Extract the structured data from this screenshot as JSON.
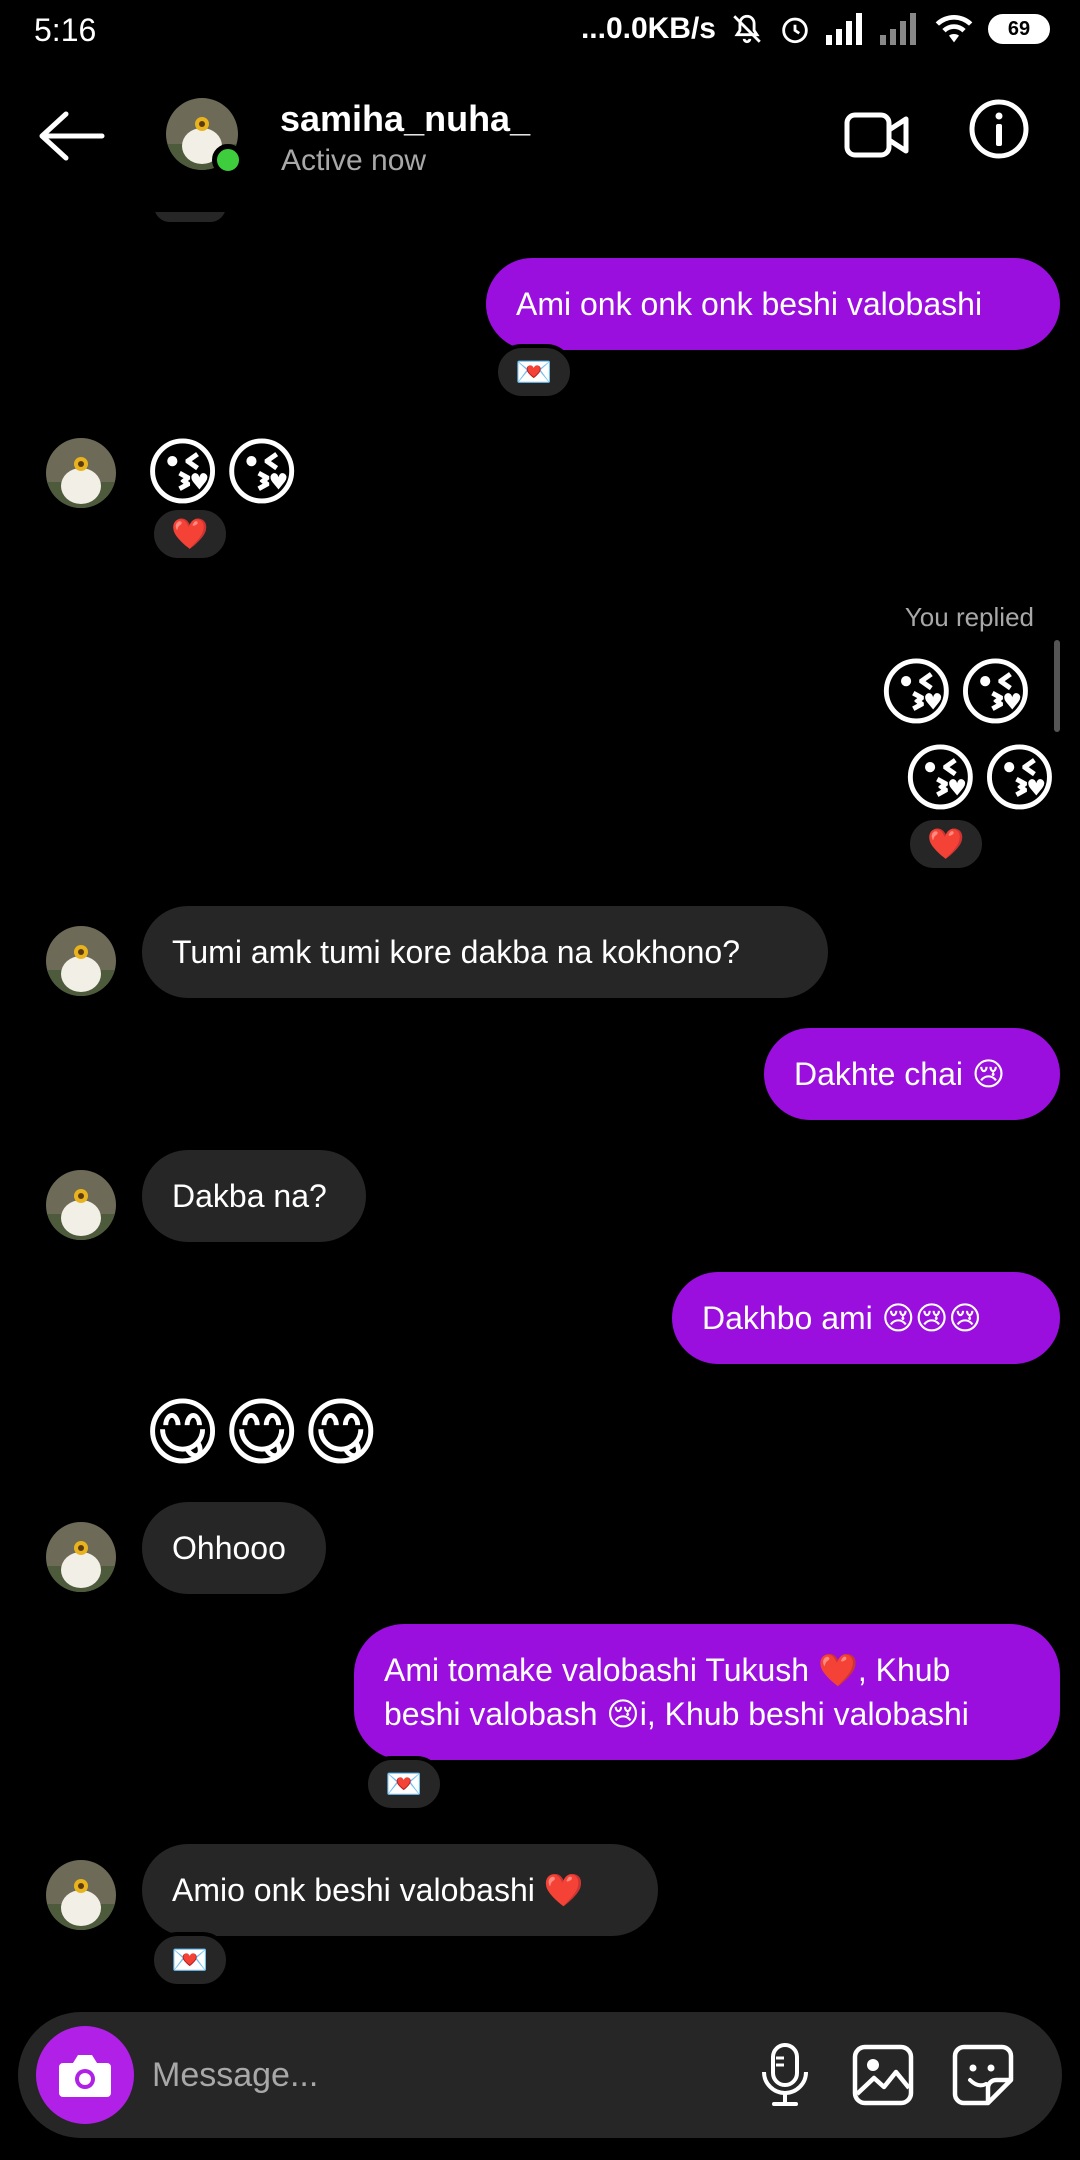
{
  "status_bar": {
    "time": "5:16",
    "network_speed": "...0.0KB/s",
    "battery": "69"
  },
  "header": {
    "username": "samiha_nuha_",
    "status": "Active now"
  },
  "messages": [
    {
      "side": "out",
      "text": "Ami onk onk onk beshi valobashi",
      "reaction": "💌"
    },
    {
      "side": "in",
      "text": "😘😘",
      "reaction": "❤️"
    },
    {
      "side": "out",
      "label": "You replied",
      "text_line1": "😘😘",
      "text_line2": "😘😘",
      "reaction": "❤️"
    },
    {
      "side": "in",
      "text": "Tumi amk tumi kore dakba na kokhono?"
    },
    {
      "side": "out",
      "text": "Dakhte chai 😢"
    },
    {
      "side": "in",
      "text": "Dakba na?"
    },
    {
      "side": "out",
      "text": "Dakhbo ami 😢😢😢"
    },
    {
      "side": "in",
      "text": "😋😋😋"
    },
    {
      "side": "in",
      "text": "Ohhooo"
    },
    {
      "side": "out",
      "text": "Ami tomake valobashi Tukush ❤️, Khub beshi valobash 😢i, Khub beshi valobashi",
      "reaction": "💌"
    },
    {
      "side": "in",
      "text": "Amio onk beshi valobashi ❤️",
      "reaction": "💌"
    }
  ],
  "composer": {
    "placeholder": "Message..."
  },
  "colors": {
    "outgoing_bubble": "#9a0fdd",
    "incoming_bubble": "#262626",
    "online": "#3dcd3d",
    "camera_button": "#b120e6"
  }
}
